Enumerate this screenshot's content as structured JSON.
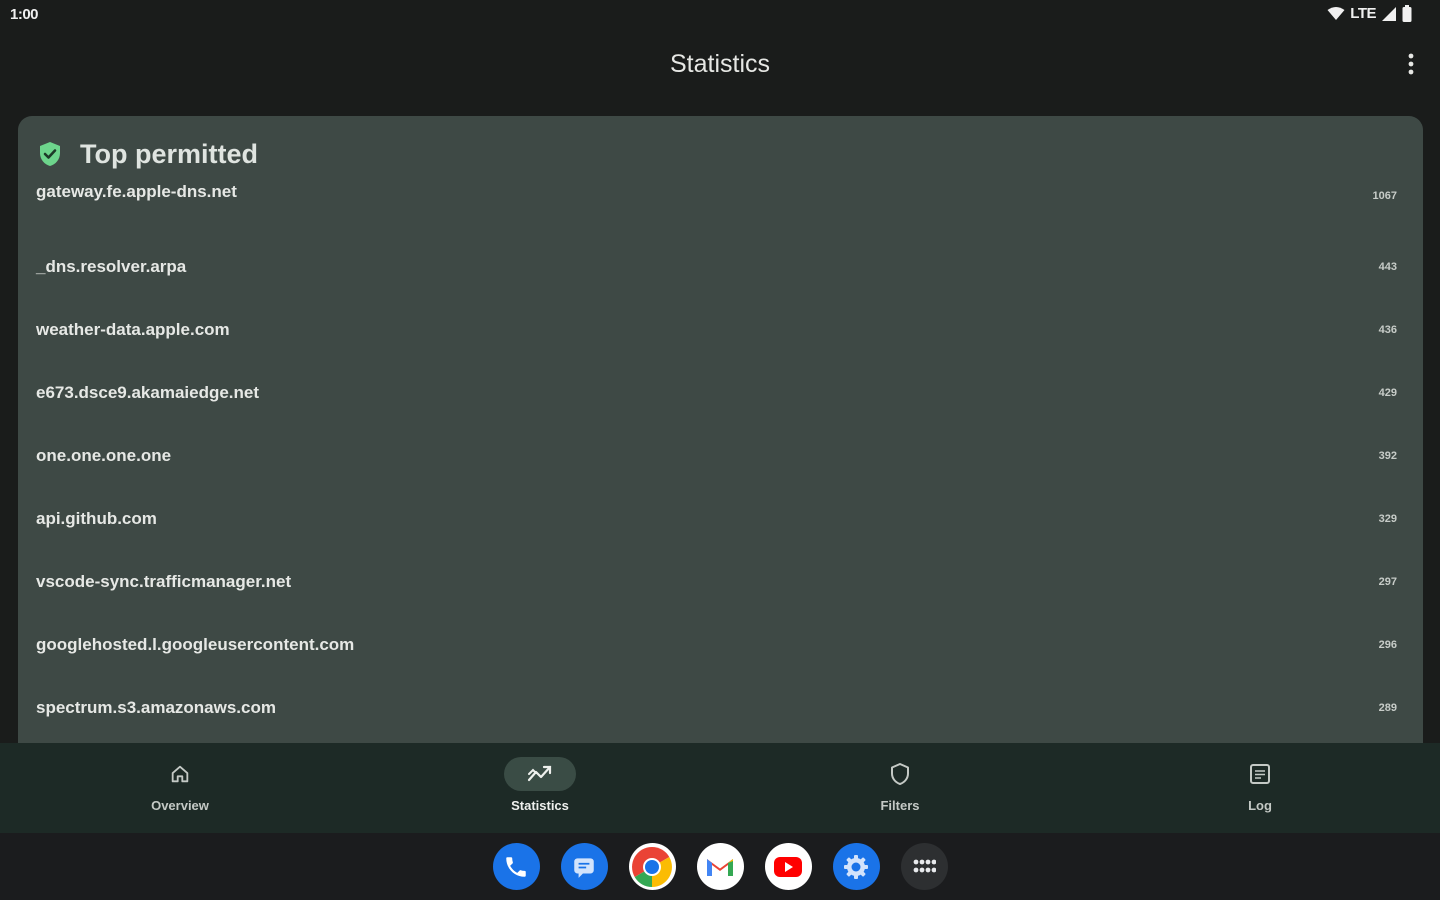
{
  "status_bar": {
    "time": "1:00",
    "network": "LTE"
  },
  "app_bar": {
    "title": "Statistics"
  },
  "card": {
    "title": "Top permitted",
    "rows": [
      {
        "domain": "gateway.fe.apple-dns.net",
        "count": "1067"
      },
      {
        "domain": "_dns.resolver.arpa",
        "count": "443"
      },
      {
        "domain": "weather-data.apple.com",
        "count": "436"
      },
      {
        "domain": "e673.dsce9.akamaiedge.net",
        "count": "429"
      },
      {
        "domain": "one.one.one.one",
        "count": "392"
      },
      {
        "domain": "api.github.com",
        "count": "329"
      },
      {
        "domain": "vscode-sync.trafficmanager.net",
        "count": "297"
      },
      {
        "domain": "googlehosted.l.googleusercontent.com",
        "count": "296"
      },
      {
        "domain": "spectrum.s3.amazonaws.com",
        "count": "289"
      }
    ]
  },
  "bottom_nav": {
    "items": [
      {
        "label": "Overview",
        "icon": "home-icon"
      },
      {
        "label": "Statistics",
        "icon": "trending-icon"
      },
      {
        "label": "Filters",
        "icon": "shield-icon"
      },
      {
        "label": "Log",
        "icon": "log-icon"
      }
    ],
    "active": "Statistics"
  },
  "dock": {
    "apps": [
      "phone-icon",
      "messages-icon",
      "chrome-icon",
      "gmail-icon",
      "youtube-icon",
      "settings-icon",
      "app-drawer-icon"
    ]
  },
  "colors": {
    "background": "#1a1c1b",
    "card": "#3e4945",
    "nav": "#1d2a26",
    "accent_green": "#6dd58c"
  }
}
